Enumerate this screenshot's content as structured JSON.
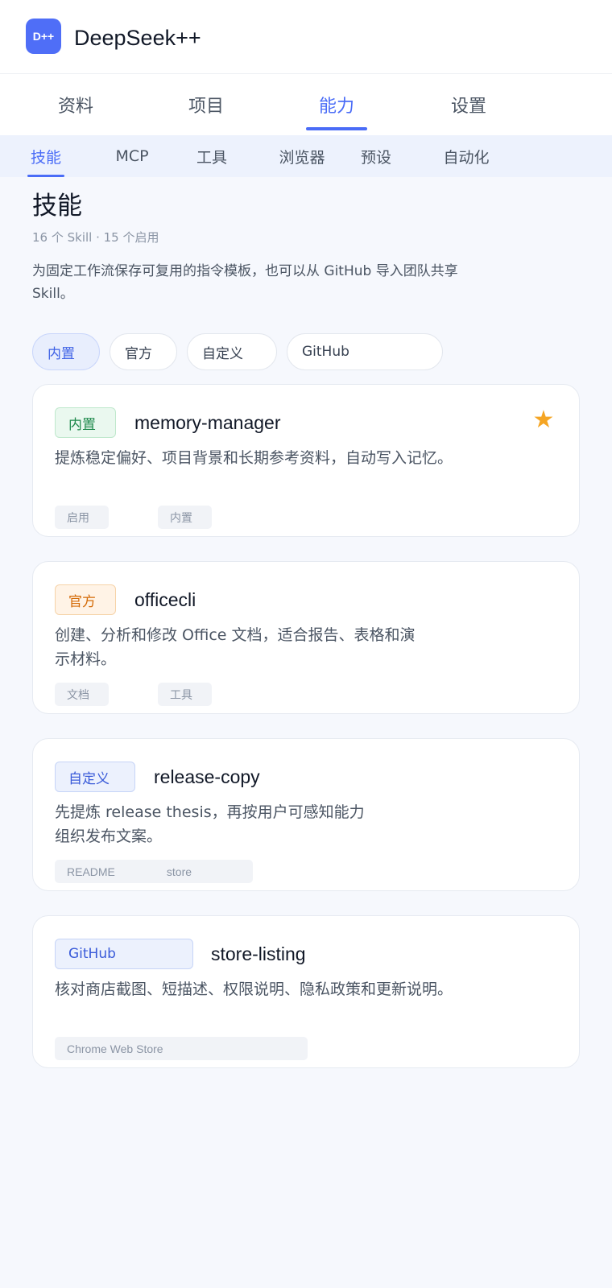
{
  "app": {
    "logo_text": "D++",
    "title": "DeepSeek++"
  },
  "main_tabs": [
    {
      "label": "资料"
    },
    {
      "label": "项目"
    },
    {
      "label": "能力"
    },
    {
      "label": "设置"
    }
  ],
  "sub_tabs": [
    {
      "label": "技能"
    },
    {
      "label": "MCP"
    },
    {
      "label": "工具"
    },
    {
      "label": "浏览器"
    },
    {
      "label": "预设"
    },
    {
      "label": "自动化"
    }
  ],
  "section": {
    "title": "技能",
    "subtitle": "16 个 Skill · 15 个启用",
    "description": "为固定工作流保存可复用的指令模板，也可以从 GitHub 导入团队共享 Skill。"
  },
  "filters": [
    {
      "label": "内置"
    },
    {
      "label": "官方"
    },
    {
      "label": "自定义"
    },
    {
      "label": "GitHub"
    }
  ],
  "cards": [
    {
      "badge": "内置",
      "name": "memory-manager",
      "description": "提炼稳定偏好、项目背景和长期参考资料，自动写入记忆。",
      "tags": [
        "启用",
        "内置"
      ],
      "star_icon": "star-icon",
      "accent": "#f5a524"
    },
    {
      "badge": "官方",
      "name": "officecli",
      "description_lines": [
        "创建、分析和修改 Office 文档，适合报告、表格和演",
        "示材料。"
      ],
      "tags": [
        "文档",
        "工具"
      ]
    },
    {
      "badge": "自定义",
      "name": "release-copy",
      "description_lines": [
        "先提炼 release thesis，再按用户可感知能力",
        "组织发布文案。"
      ],
      "tags": [
        "README",
        "store"
      ]
    },
    {
      "badge": "GitHub",
      "name": "store-listing",
      "description": "核对商店截图、短描述、权限说明、隐私政策和更新说明。",
      "tags": [
        "Chrome Web Store"
      ]
    }
  ],
  "colors": {
    "primary": "#4a6cf7",
    "background": "#f6f8fd"
  }
}
